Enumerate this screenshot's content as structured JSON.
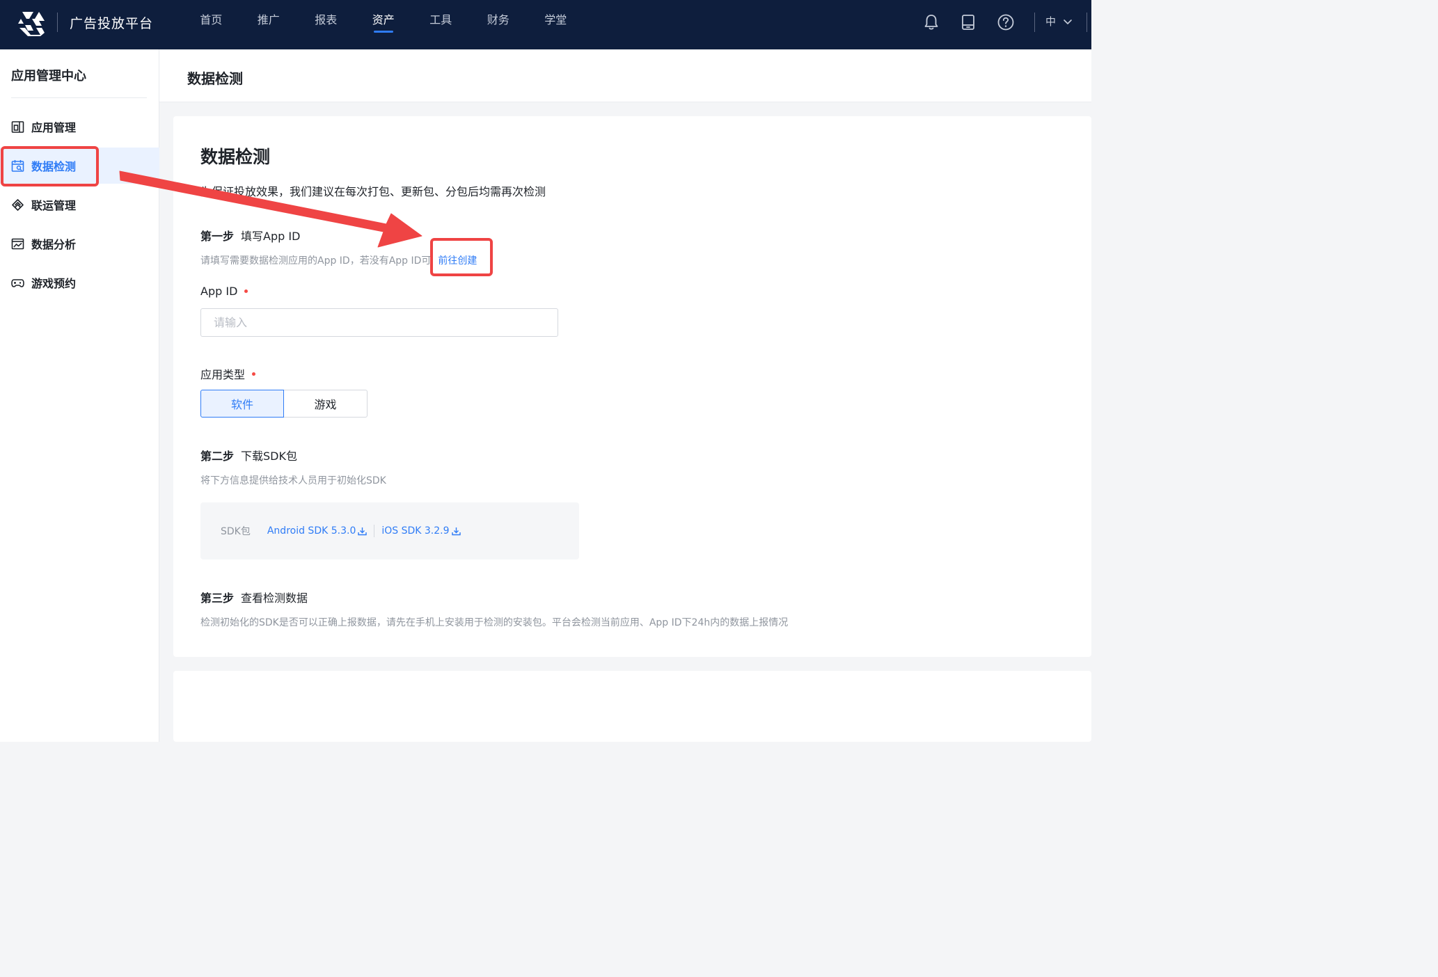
{
  "topbar": {
    "brand": "广告投放平台",
    "nav": [
      "首页",
      "推广",
      "报表",
      "资产",
      "工具",
      "财务",
      "学堂"
    ],
    "active_nav": "资产",
    "lang": "中"
  },
  "sidebar": {
    "title": "应用管理中心",
    "items": [
      {
        "label": "应用管理",
        "icon": "app-manage-icon"
      },
      {
        "label": "数据检测",
        "icon": "calendar-search-icon"
      },
      {
        "label": "联运管理",
        "icon": "diamond-link-icon"
      },
      {
        "label": "数据分析",
        "icon": "chart-window-icon"
      },
      {
        "label": "游戏预约",
        "icon": "gamepad-icon"
      }
    ],
    "active_item": "数据检测"
  },
  "header": {
    "title": "数据检测"
  },
  "main": {
    "title": "数据检测",
    "intro": "为保证投放效果，我们建议在每次打包、更新包、分包后均需再次检测",
    "step1": {
      "step": "第一步",
      "title": "填写App ID",
      "hint": "请填写需要数据检测应用的App ID，若没有App ID可",
      "link": "前往创建"
    },
    "app_id": {
      "label": "App ID",
      "placeholder": "请输入",
      "value": ""
    },
    "app_type": {
      "label": "应用类型",
      "options": [
        "软件",
        "游戏"
      ],
      "selected": "软件"
    },
    "step2": {
      "step": "第二步",
      "title": "下载SDK包",
      "hint": "将下方信息提供给技术人员用于初始化SDK"
    },
    "sdk": {
      "label": "SDK包",
      "android": "Android SDK 5.3.0",
      "ios": "iOS SDK 3.2.9"
    },
    "step3": {
      "step": "第三步",
      "title": "查看检测数据",
      "hint": "检测初始化的SDK是否可以正确上报数据，请先在手机上安装用于检测的安装包。平台会检测当前应用、App ID下24h内的数据上报情况"
    }
  },
  "colors": {
    "topbar": "#0e1e3d",
    "accent": "#2f7cf6",
    "annotation": "#ef4444",
    "required": "#f54a45"
  }
}
